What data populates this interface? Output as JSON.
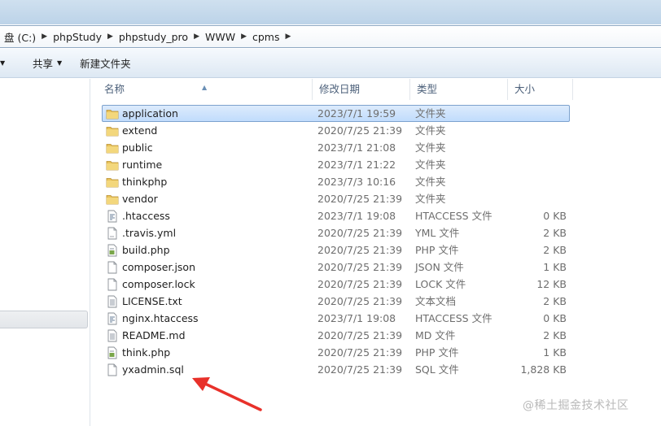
{
  "breadcrumb": {
    "items": [
      "盘 (C:)",
      "phpStudy",
      "phpstudy_pro",
      "WWW",
      "cpms"
    ]
  },
  "toolbar": {
    "share_label": "共享",
    "new_folder_label": "新建文件夹"
  },
  "columns": {
    "name": "名称",
    "date": "修改日期",
    "type": "类型",
    "size": "大小"
  },
  "files": [
    {
      "name": "application",
      "date": "2023/7/1 19:59",
      "type": "文件夹",
      "size": "",
      "icon": "folder-icon",
      "selected": true
    },
    {
      "name": "extend",
      "date": "2020/7/25 21:39",
      "type": "文件夹",
      "size": "",
      "icon": "folder-icon"
    },
    {
      "name": "public",
      "date": "2023/7/1 21:08",
      "type": "文件夹",
      "size": "",
      "icon": "folder-icon"
    },
    {
      "name": "runtime",
      "date": "2023/7/1 21:22",
      "type": "文件夹",
      "size": "",
      "icon": "folder-icon"
    },
    {
      "name": "thinkphp",
      "date": "2023/7/3 10:16",
      "type": "文件夹",
      "size": "",
      "icon": "folder-icon"
    },
    {
      "name": "vendor",
      "date": "2020/7/25 21:39",
      "type": "文件夹",
      "size": "",
      "icon": "folder-icon"
    },
    {
      "name": ".htaccess",
      "date": "2023/7/1 19:08",
      "type": "HTACCESS 文件",
      "size": "0 KB",
      "icon": "config-file-icon"
    },
    {
      "name": ".travis.yml",
      "date": "2020/7/25 21:39",
      "type": "YML 文件",
      "size": "2 KB",
      "icon": "document-icon"
    },
    {
      "name": "build.php",
      "date": "2020/7/25 21:39",
      "type": "PHP 文件",
      "size": "2 KB",
      "icon": "script-file-icon"
    },
    {
      "name": "composer.json",
      "date": "2020/7/25 21:39",
      "type": "JSON 文件",
      "size": "1 KB",
      "icon": "blank-file-icon"
    },
    {
      "name": "composer.lock",
      "date": "2020/7/25 21:39",
      "type": "LOCK 文件",
      "size": "12 KB",
      "icon": "blank-file-icon"
    },
    {
      "name": "LICENSE.txt",
      "date": "2020/7/25 21:39",
      "type": "文本文档",
      "size": "2 KB",
      "icon": "text-file-icon"
    },
    {
      "name": "nginx.htaccess",
      "date": "2023/7/1 19:08",
      "type": "HTACCESS 文件",
      "size": "0 KB",
      "icon": "config-file-icon"
    },
    {
      "name": "README.md",
      "date": "2020/7/25 21:39",
      "type": "MD 文件",
      "size": "2 KB",
      "icon": "text-file-icon"
    },
    {
      "name": "think.php",
      "date": "2020/7/25 21:39",
      "type": "PHP 文件",
      "size": "1 KB",
      "icon": "script-file-icon"
    },
    {
      "name": "yxadmin.sql",
      "date": "2020/7/25 21:39",
      "type": "SQL 文件",
      "size": "1,828 KB",
      "icon": "blank-file-icon"
    }
  ],
  "annotation": {
    "arrow_color": "#e8312a",
    "arrow_target": "yxadmin.sql"
  },
  "watermark": "@稀土掘金技术社区",
  "colors": {
    "selection": "#c9e0fc",
    "selection_border": "#7da2ce",
    "folder": "#e8c25a",
    "header_text": "#4c607a"
  }
}
